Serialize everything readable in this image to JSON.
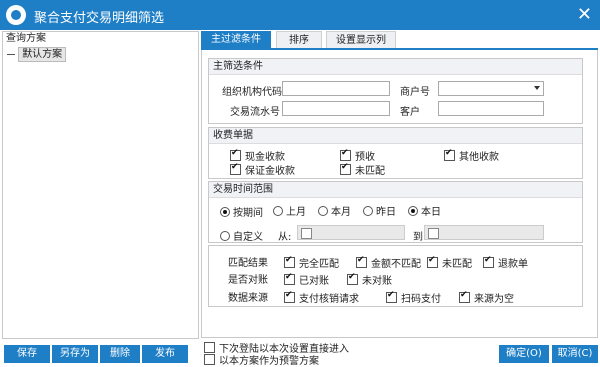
{
  "window": {
    "title": "聚合支付交易明细筛选",
    "logo_icon": "eye-logo-icon",
    "close_icon": "close-icon"
  },
  "left": {
    "header": "查询方案",
    "tree_node": "默认方案"
  },
  "tabs": [
    {
      "label": "主过滤条件"
    },
    {
      "label": "排序"
    },
    {
      "label": "设置显示列"
    }
  ],
  "main_filter": {
    "title": "主筛选条件",
    "org_code_label": "组织机构代码",
    "org_code_value": "",
    "merchant_label": "商户号",
    "merchant_value": "",
    "serial_label": "交易流水号",
    "serial_value": "",
    "customer_label": "客户",
    "customer_value": ""
  },
  "fee_docs": {
    "title": "收费单据",
    "items": [
      {
        "label": "现金收款",
        "checked": true
      },
      {
        "label": "预收",
        "checked": true
      },
      {
        "label": "其他收款",
        "checked": true
      },
      {
        "label": "保证金收款",
        "checked": true
      },
      {
        "label": "未匹配",
        "checked": true
      }
    ]
  },
  "time_range": {
    "title": "交易时间范围",
    "by_period": "按期间",
    "periods": [
      {
        "label": "上月",
        "selected": false
      },
      {
        "label": "本月",
        "selected": false
      },
      {
        "label": "昨日",
        "selected": false
      },
      {
        "label": "本日",
        "selected": true
      }
    ],
    "custom": "自定义",
    "from": "从:",
    "to": "到"
  },
  "match": {
    "result_label": "匹配结果",
    "results": [
      {
        "label": "完全匹配",
        "checked": true
      },
      {
        "label": "金额不匹配",
        "checked": true
      },
      {
        "label": "未匹配",
        "checked": true
      },
      {
        "label": "退款单",
        "checked": true
      }
    ],
    "reconciled_label": "是否对账",
    "reconciled": [
      {
        "label": "已对账",
        "checked": true
      },
      {
        "label": "未对账",
        "checked": true
      }
    ],
    "source_label": "数据来源",
    "sources": [
      {
        "label": "支付核销请求",
        "checked": true
      },
      {
        "label": "扫码支付",
        "checked": true
      },
      {
        "label": "来源为空",
        "checked": true
      }
    ]
  },
  "footer": {
    "save": "保存",
    "save_as": "另存为",
    "delete": "删除",
    "publish": "发布",
    "next_login": "下次登陆以本次设置直接进入",
    "as_alert": "以本方案作为预警方案",
    "ok": "确定(O)",
    "cancel": "取消(C)"
  }
}
